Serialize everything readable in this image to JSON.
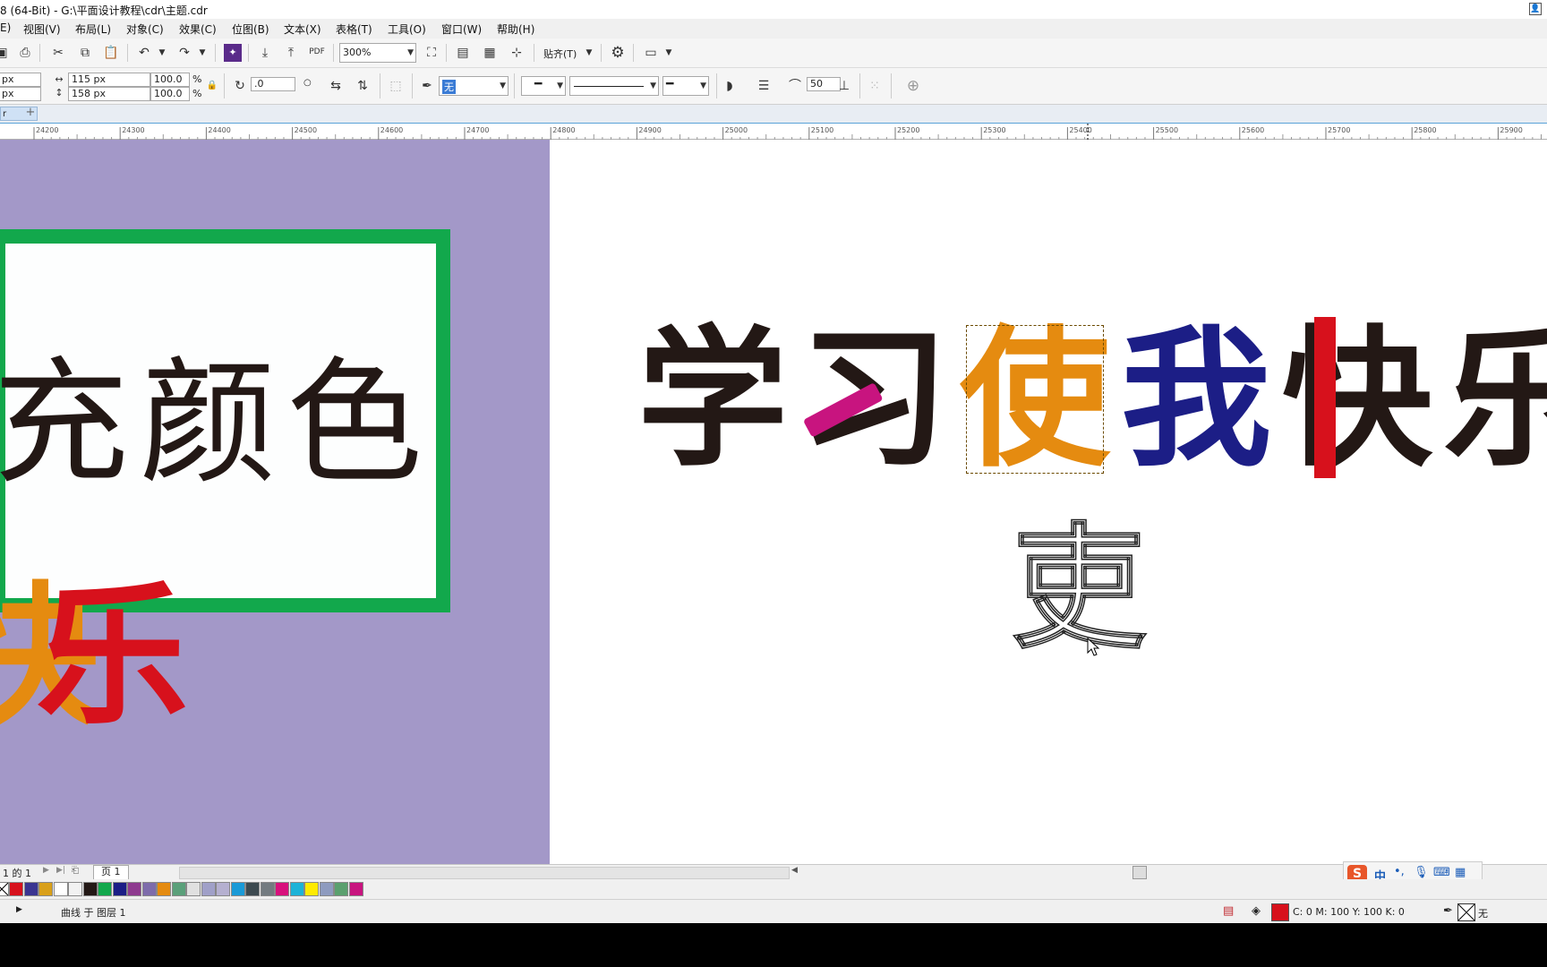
{
  "titlebar": {
    "title": "8 (64-Bit) - G:\\平面设计教程\\cdr\\主题.cdr"
  },
  "menu": {
    "items": [
      "视图(V)",
      "布局(L)",
      "对象(C)",
      "效果(C)",
      "位图(B)",
      "文本(X)",
      "表格(T)",
      "工具(O)",
      "窗口(W)",
      "帮助(H)"
    ]
  },
  "toolbar": {
    "zoom": "300%",
    "snap_label": "贴齐(T)",
    "pdf_label": "PDF"
  },
  "propbar": {
    "x_unit": "px",
    "y_unit": "px",
    "width": "115 px",
    "height": "158 px",
    "scale_x": "100.0",
    "scale_y": "100.0",
    "percent": "%",
    "rotation": ".0",
    "degree": "○",
    "outline_color": "无",
    "smoothing": "50"
  },
  "doc": {
    "tab_label": "r"
  },
  "ruler": {
    "ticks": [
      "24200",
      "24300",
      "24400",
      "24500",
      "24600",
      "24700",
      "24800",
      "24900",
      "25000",
      "25100",
      "25200",
      "25300",
      "25400",
      "25500",
      "25600",
      "25700",
      "25800",
      "25900"
    ]
  },
  "canvas": {
    "green_text": "充颜色",
    "headline_chars": [
      {
        "char": "学",
        "color": "#231815"
      },
      {
        "char": "习",
        "color": "#231815"
      },
      {
        "char": "使",
        "color": "#e58b10"
      },
      {
        "char": "我",
        "color": "#1c1e86"
      },
      {
        "char": "快",
        "color": "#231815"
      },
      {
        "char": "乐",
        "color": "#231815"
      }
    ],
    "bottom_left_chars": [
      {
        "char": "快",
        "color": "#e58b10"
      },
      {
        "char": "乐",
        "color": "#d7111c"
      }
    ],
    "outline_char": "吏"
  },
  "pagenav": {
    "page_count": "1 的 1",
    "page_tab": "页 1"
  },
  "palette": {
    "colors": [
      "#d7111c",
      "#3a3591",
      "#d9a01a",
      "#ffffff",
      "#f2f2f2",
      "#231815",
      "#12a84c",
      "#1c1e86",
      "#8e3a8f",
      "#7e6cab",
      "#e58b10",
      "#5aa07a",
      "#e0e0e0",
      "#a0a0c8",
      "#b5b0d0",
      "#1a9ad7",
      "#3d4a50",
      "#737b80",
      "#d8117d",
      "#1db3d8",
      "#ffeb00",
      "#8e9bbf",
      "#5aa06e",
      "#c8147f"
    ]
  },
  "status": {
    "object_info": "曲线 于 图层 1",
    "fill_color": "#d7111c",
    "fill_info": "C: 0 M: 100 Y: 100 K: 0",
    "outline_info": "无"
  },
  "ime": {
    "label": "中"
  }
}
